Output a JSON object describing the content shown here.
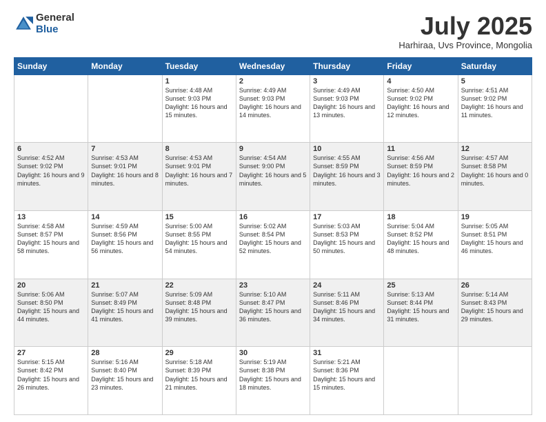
{
  "logo": {
    "general": "General",
    "blue": "Blue"
  },
  "header": {
    "month": "July 2025",
    "location": "Harhiraa, Uvs Province, Mongolia"
  },
  "weekdays": [
    "Sunday",
    "Monday",
    "Tuesday",
    "Wednesday",
    "Thursday",
    "Friday",
    "Saturday"
  ],
  "weeks": [
    [
      {
        "day": "",
        "text": ""
      },
      {
        "day": "",
        "text": ""
      },
      {
        "day": "1",
        "text": "Sunrise: 4:48 AM\nSunset: 9:03 PM\nDaylight: 16 hours and 15 minutes."
      },
      {
        "day": "2",
        "text": "Sunrise: 4:49 AM\nSunset: 9:03 PM\nDaylight: 16 hours and 14 minutes."
      },
      {
        "day": "3",
        "text": "Sunrise: 4:49 AM\nSunset: 9:03 PM\nDaylight: 16 hours and 13 minutes."
      },
      {
        "day": "4",
        "text": "Sunrise: 4:50 AM\nSunset: 9:02 PM\nDaylight: 16 hours and 12 minutes."
      },
      {
        "day": "5",
        "text": "Sunrise: 4:51 AM\nSunset: 9:02 PM\nDaylight: 16 hours and 11 minutes."
      }
    ],
    [
      {
        "day": "6",
        "text": "Sunrise: 4:52 AM\nSunset: 9:02 PM\nDaylight: 16 hours and 9 minutes."
      },
      {
        "day": "7",
        "text": "Sunrise: 4:53 AM\nSunset: 9:01 PM\nDaylight: 16 hours and 8 minutes."
      },
      {
        "day": "8",
        "text": "Sunrise: 4:53 AM\nSunset: 9:01 PM\nDaylight: 16 hours and 7 minutes."
      },
      {
        "day": "9",
        "text": "Sunrise: 4:54 AM\nSunset: 9:00 PM\nDaylight: 16 hours and 5 minutes."
      },
      {
        "day": "10",
        "text": "Sunrise: 4:55 AM\nSunset: 8:59 PM\nDaylight: 16 hours and 3 minutes."
      },
      {
        "day": "11",
        "text": "Sunrise: 4:56 AM\nSunset: 8:59 PM\nDaylight: 16 hours and 2 minutes."
      },
      {
        "day": "12",
        "text": "Sunrise: 4:57 AM\nSunset: 8:58 PM\nDaylight: 16 hours and 0 minutes."
      }
    ],
    [
      {
        "day": "13",
        "text": "Sunrise: 4:58 AM\nSunset: 8:57 PM\nDaylight: 15 hours and 58 minutes."
      },
      {
        "day": "14",
        "text": "Sunrise: 4:59 AM\nSunset: 8:56 PM\nDaylight: 15 hours and 56 minutes."
      },
      {
        "day": "15",
        "text": "Sunrise: 5:00 AM\nSunset: 8:55 PM\nDaylight: 15 hours and 54 minutes."
      },
      {
        "day": "16",
        "text": "Sunrise: 5:02 AM\nSunset: 8:54 PM\nDaylight: 15 hours and 52 minutes."
      },
      {
        "day": "17",
        "text": "Sunrise: 5:03 AM\nSunset: 8:53 PM\nDaylight: 15 hours and 50 minutes."
      },
      {
        "day": "18",
        "text": "Sunrise: 5:04 AM\nSunset: 8:52 PM\nDaylight: 15 hours and 48 minutes."
      },
      {
        "day": "19",
        "text": "Sunrise: 5:05 AM\nSunset: 8:51 PM\nDaylight: 15 hours and 46 minutes."
      }
    ],
    [
      {
        "day": "20",
        "text": "Sunrise: 5:06 AM\nSunset: 8:50 PM\nDaylight: 15 hours and 44 minutes."
      },
      {
        "day": "21",
        "text": "Sunrise: 5:07 AM\nSunset: 8:49 PM\nDaylight: 15 hours and 41 minutes."
      },
      {
        "day": "22",
        "text": "Sunrise: 5:09 AM\nSunset: 8:48 PM\nDaylight: 15 hours and 39 minutes."
      },
      {
        "day": "23",
        "text": "Sunrise: 5:10 AM\nSunset: 8:47 PM\nDaylight: 15 hours and 36 minutes."
      },
      {
        "day": "24",
        "text": "Sunrise: 5:11 AM\nSunset: 8:46 PM\nDaylight: 15 hours and 34 minutes."
      },
      {
        "day": "25",
        "text": "Sunrise: 5:13 AM\nSunset: 8:44 PM\nDaylight: 15 hours and 31 minutes."
      },
      {
        "day": "26",
        "text": "Sunrise: 5:14 AM\nSunset: 8:43 PM\nDaylight: 15 hours and 29 minutes."
      }
    ],
    [
      {
        "day": "27",
        "text": "Sunrise: 5:15 AM\nSunset: 8:42 PM\nDaylight: 15 hours and 26 minutes."
      },
      {
        "day": "28",
        "text": "Sunrise: 5:16 AM\nSunset: 8:40 PM\nDaylight: 15 hours and 23 minutes."
      },
      {
        "day": "29",
        "text": "Sunrise: 5:18 AM\nSunset: 8:39 PM\nDaylight: 15 hours and 21 minutes."
      },
      {
        "day": "30",
        "text": "Sunrise: 5:19 AM\nSunset: 8:38 PM\nDaylight: 15 hours and 18 minutes."
      },
      {
        "day": "31",
        "text": "Sunrise: 5:21 AM\nSunset: 8:36 PM\nDaylight: 15 hours and 15 minutes."
      },
      {
        "day": "",
        "text": ""
      },
      {
        "day": "",
        "text": ""
      }
    ]
  ]
}
